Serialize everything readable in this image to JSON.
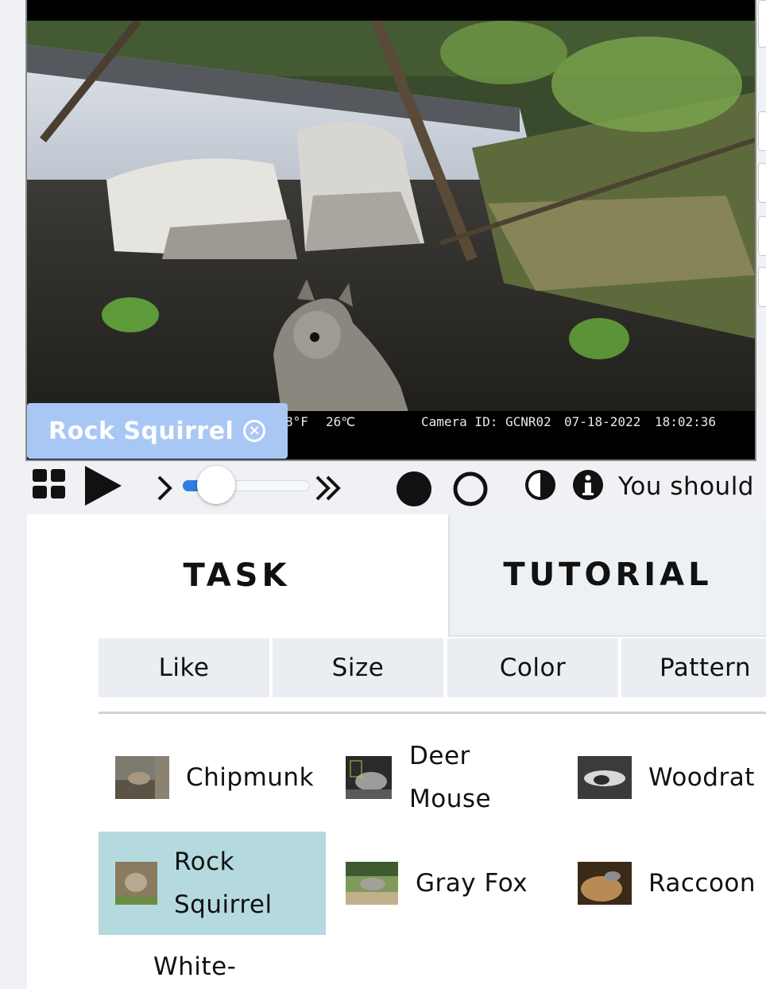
{
  "viewer": {
    "overlay": {
      "temp_f": "8°F",
      "temp_c": "26℃",
      "camera_id": "Camera ID: GCNR02",
      "date": "07-18-2022",
      "time": "18:02:36"
    },
    "selected_tag": "Rock Squirrel",
    "tag_close": "×"
  },
  "controls": {
    "icons": [
      "grid-icon",
      "play-icon",
      "step-forward-icon",
      "fast-forward-icon",
      "filled-circle-icon",
      "hollow-circle-icon",
      "contrast-icon",
      "info-icon"
    ],
    "speed_slider_value": 0.15,
    "info_text": "You should"
  },
  "tabs": [
    {
      "label": "TASK",
      "active": true
    },
    {
      "label": "TUTORIAL",
      "active": false
    }
  ],
  "filters": [
    "Like",
    "Size",
    "Color",
    "Pattern"
  ],
  "species": [
    {
      "name": "Chipmunk",
      "selected": false
    },
    {
      "name": "Deer Mouse",
      "selected": false
    },
    {
      "name": "Woodrat",
      "selected": false
    },
    {
      "name": "Rock Squirrel",
      "selected": true
    },
    {
      "name": "Gray Fox",
      "selected": false
    },
    {
      "name": "Raccoon",
      "selected": false
    },
    {
      "name": "White-",
      "selected": false
    }
  ],
  "colors": {
    "tag_bg": "#a9c7f5",
    "selected_cell": "#b4dadf",
    "slider_fill": "#2f7de1",
    "page_bg": "#eff1f4"
  }
}
